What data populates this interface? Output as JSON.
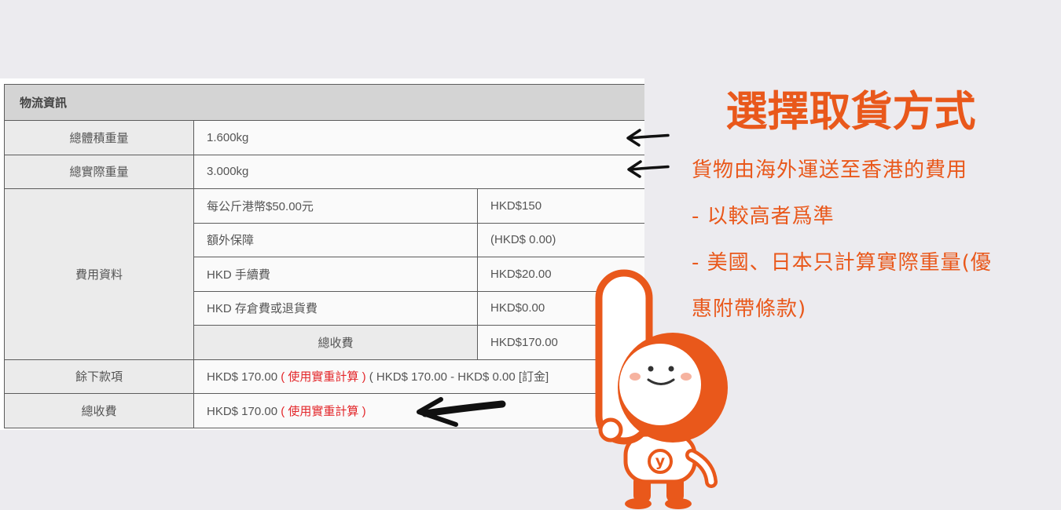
{
  "colors": {
    "background": "#ecebef",
    "accent": "#e9581b",
    "border": "#5c5c5c",
    "header_bg": "#d4d4d4",
    "label_bg": "#ebebeb",
    "value_bg": "#fafafa",
    "text": "#555555",
    "note_red": "#e3262a",
    "arrow": "#111111",
    "mascot_cheek": "#f6b3a0"
  },
  "icons": {
    "annotation_arrow": "arrow-left-icon",
    "mascot": "mascot-illustration"
  },
  "table": {
    "header": "物流資訊",
    "volumetric_weight": {
      "label": "總體積重量",
      "value": "1.600kg"
    },
    "actual_weight": {
      "label": "總實際重量",
      "value": "3.000kg"
    },
    "fees": {
      "label": "費用資料",
      "items": [
        {
          "name": "每公斤港幣$50.00元",
          "amount": "HKD$150"
        },
        {
          "name": "額外保障",
          "amount": "(HKD$ 0.00)"
        },
        {
          "name": "HKD 手續費",
          "amount": "HKD$20.00"
        },
        {
          "name": "HKD 存倉費或退貨費",
          "amount": "HKD$0.00"
        }
      ],
      "total": {
        "name": "總收費",
        "amount": "HKD$170.00"
      }
    },
    "balance": {
      "label": "餘下款項",
      "amount": "HKD$ 170.00",
      "note": "( 使用實重計算 )",
      "detail": "( HKD$ 170.00 - HKD$ 0.00 [訂金]"
    },
    "grand_total": {
      "label": "總收費",
      "amount": "HKD$ 170.00",
      "note": "( 使用實重計算 )"
    }
  },
  "panel": {
    "title": "選擇取貨方式",
    "lines": [
      "貨物由海外運送至香港的費用",
      "- 以較高者爲準",
      "- 美國、日本只計算實際重量(優",
      "惠附帶條款)"
    ]
  },
  "mascot": {
    "badge_letter": "y"
  }
}
